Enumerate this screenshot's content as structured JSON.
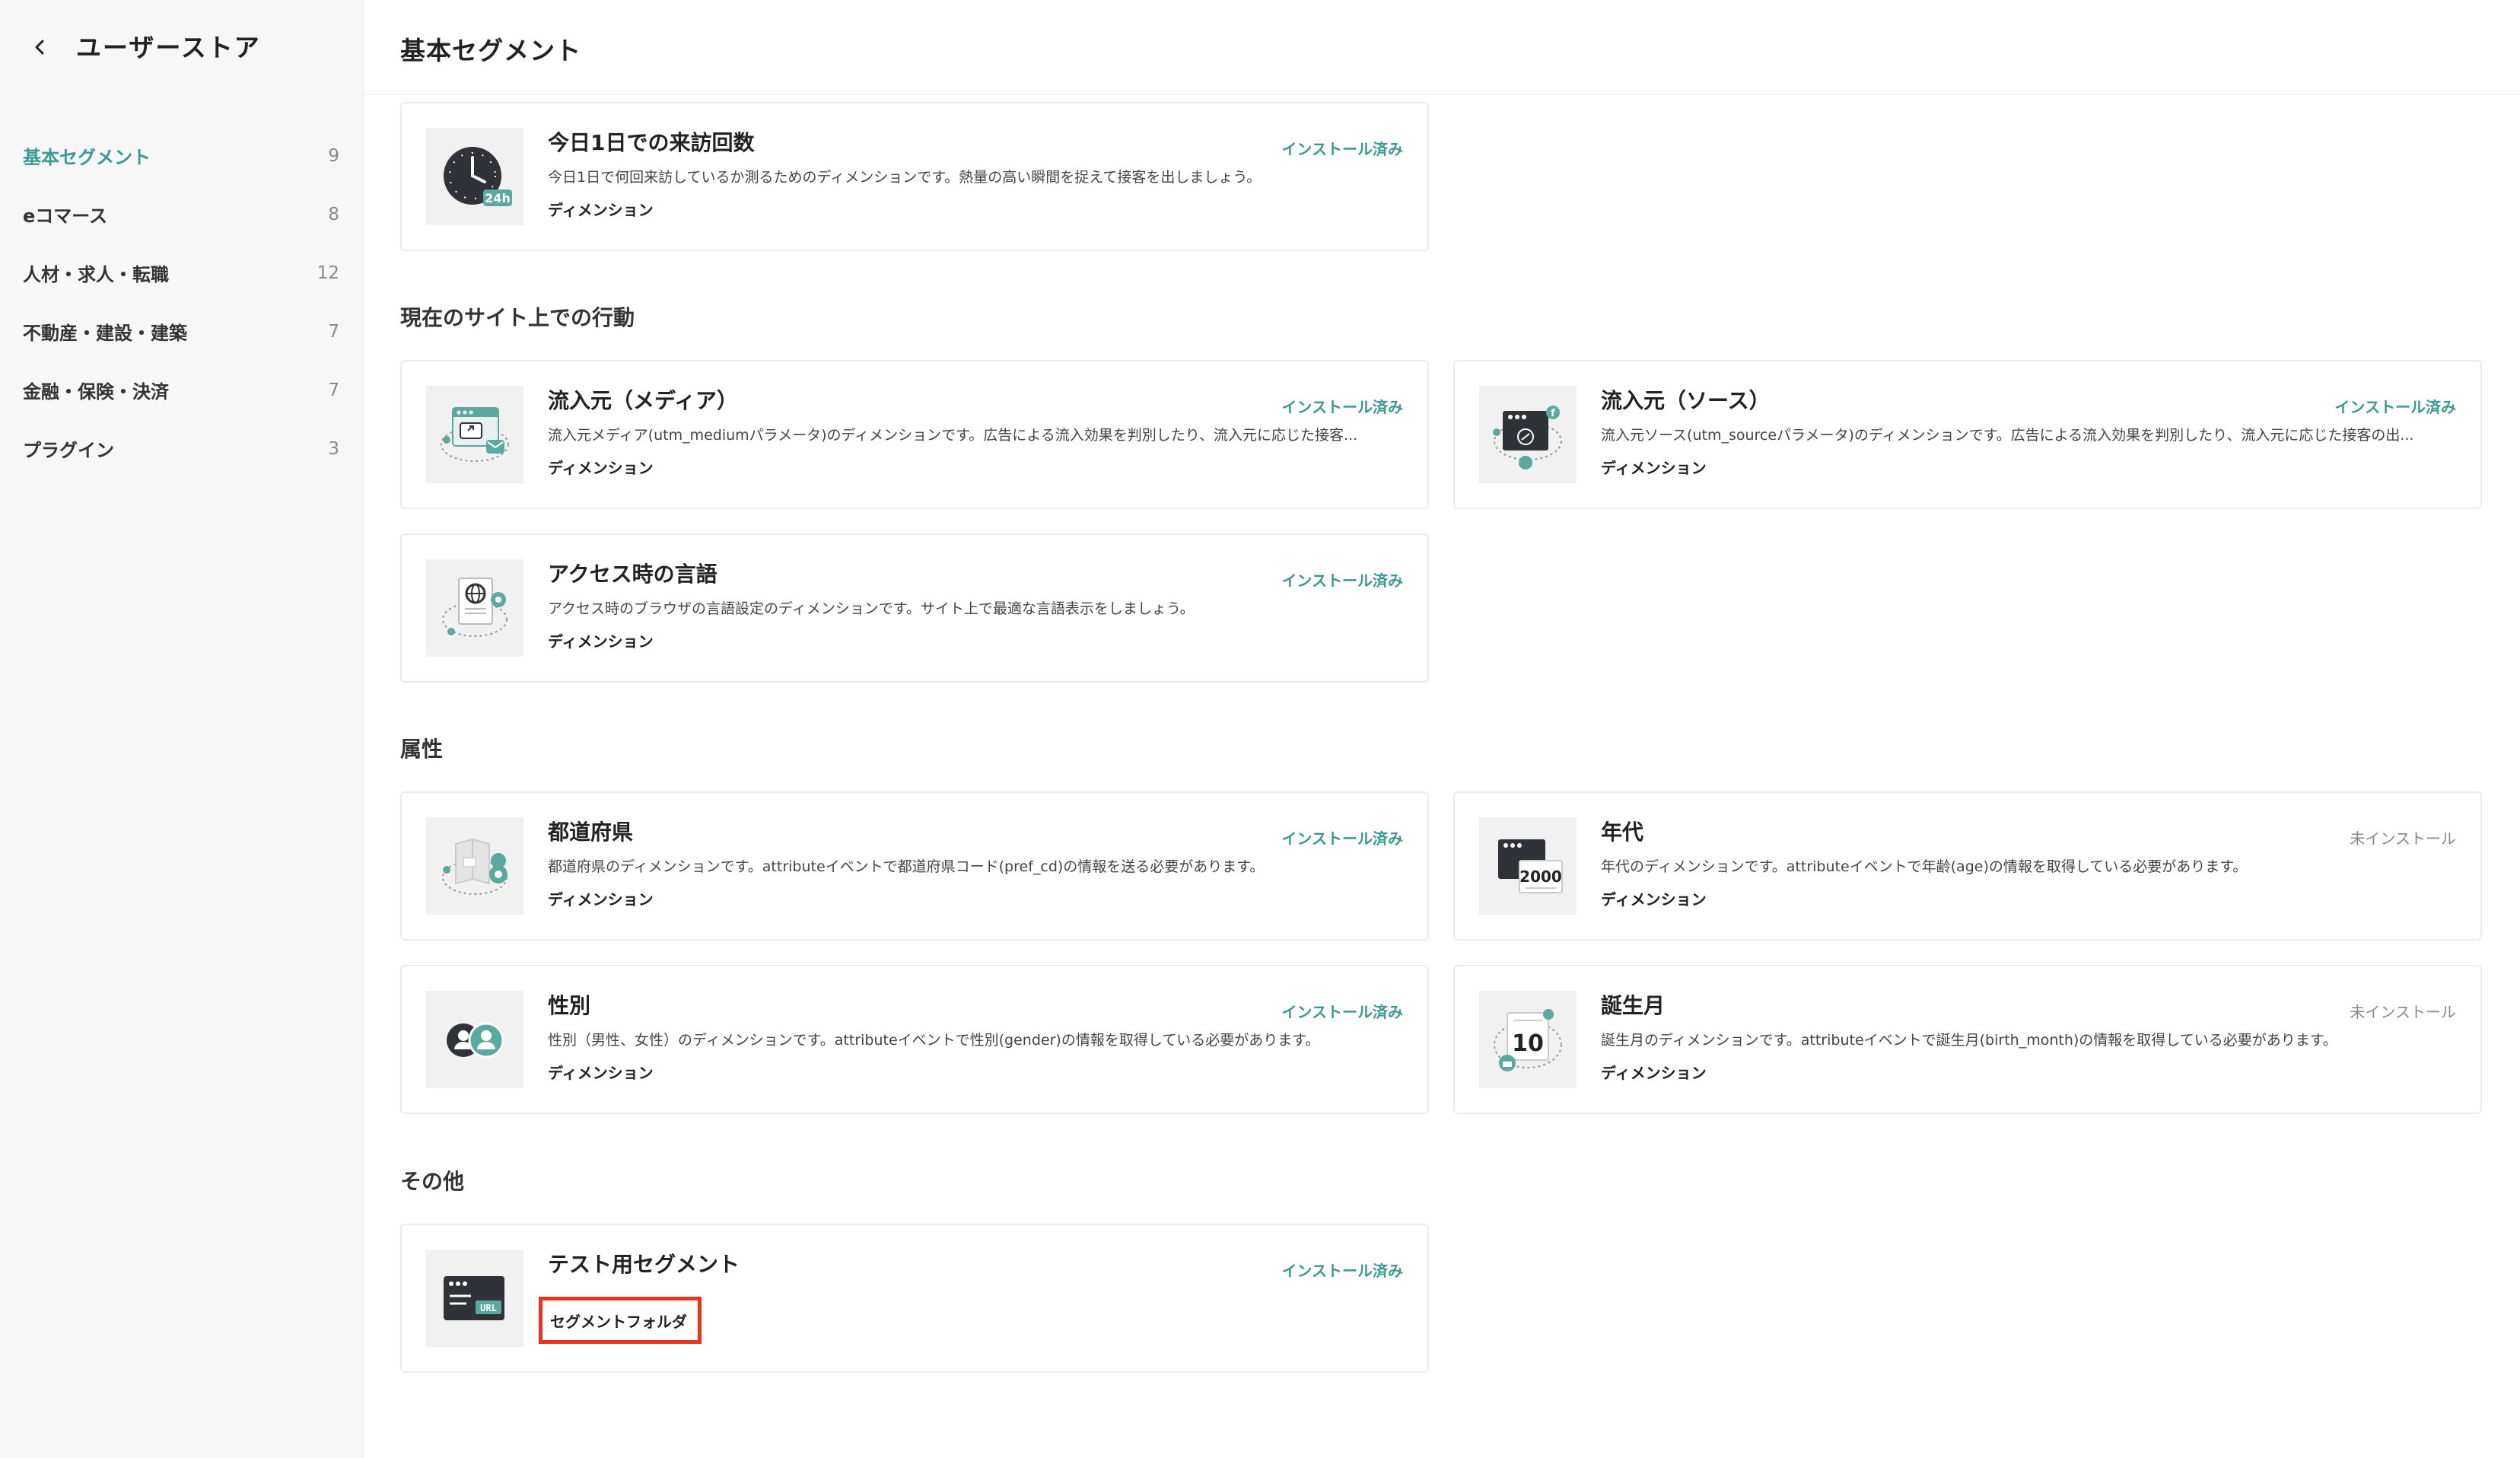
{
  "sidebar": {
    "back_icon": "chevron-left-icon",
    "title": "ユーザーストア",
    "items": [
      {
        "label": "基本セグメント",
        "count": "9"
      },
      {
        "label": "eコマース",
        "count": "8"
      },
      {
        "label": "人材・求人・転職",
        "count": "12"
      },
      {
        "label": "不動産・建設・建築",
        "count": "7"
      },
      {
        "label": "金融・保険・決済",
        "count": "7"
      },
      {
        "label": "プラグイン",
        "count": "3"
      }
    ]
  },
  "header": {
    "title": "基本セグメント"
  },
  "colors": {
    "accent": "#3a9a92",
    "highlight": "#e8331f",
    "icon_dark": "#2f3236",
    "icon_teal": "#5aa99f"
  },
  "cards": {
    "visits": {
      "title": "今日1日での来訪回数",
      "desc": "今日1日で何回来訪しているか測るためのディメンションです。熱量の高い瞬間を捉えて接客を出しましょう。",
      "type": "ディメンション",
      "status": "インストール済み",
      "icon": "clock-24h-icon",
      "badge": "24h"
    },
    "media": {
      "title": "流入元（メディア）",
      "desc": "流入元メディア(utm_mediumパラメータ)のディメンションです。広告による流入効果を判別したり、流入元に応じた接客...",
      "type": "ディメンション",
      "status": "インストール済み",
      "icon": "media-link-icon"
    },
    "source": {
      "title": "流入元（ソース）",
      "desc": "流入元ソース(utm_sourceパラメータ)のディメンションです。広告による流入効果を判別したり、流入元に応じた接客の出...",
      "type": "ディメンション",
      "status": "インストール済み",
      "icon": "source-link-icon"
    },
    "language": {
      "title": "アクセス時の言語",
      "desc": "アクセス時のブラウザの言語設定のディメンションです。サイト上で最適な言語表示をしましょう。",
      "type": "ディメンション",
      "status": "インストール済み",
      "icon": "globe-language-icon"
    },
    "prefecture": {
      "title": "都道府県",
      "desc": "都道府県のディメンションです。attributeイベントで都道府県コード(pref_cd)の情報を送る必要があります。",
      "type": "ディメンション",
      "status": "インストール済み",
      "icon": "map-pin-icon"
    },
    "age": {
      "title": "年代",
      "desc": "年代のディメンションです。attributeイベントで年齢(age)の情報を取得している必要があります。",
      "type": "ディメンション",
      "status": "未インストール",
      "icon": "age-calendar-icon",
      "badge": "2000"
    },
    "gender": {
      "title": "性別",
      "desc": "性別（男性、女性）のディメンションです。attributeイベントで性別(gender)の情報を取得している必要があります。",
      "type": "ディメンション",
      "status": "インストール済み",
      "icon": "gender-users-icon"
    },
    "birth_month": {
      "title": "誕生月",
      "desc": "誕生月のディメンションです。attributeイベントで誕生月(birth_month)の情報を取得している必要があります。",
      "type": "ディメンション",
      "status": "未インストール",
      "icon": "birthday-calendar-icon",
      "badge": "10"
    },
    "test": {
      "title": "テスト用セグメント",
      "type": "セグメントフォルダ",
      "status": "インストール済み",
      "icon": "url-window-icon",
      "badge": "URL"
    }
  },
  "sections": {
    "behavior": "現在のサイト上での行動",
    "attributes": "属性",
    "other": "その他"
  }
}
